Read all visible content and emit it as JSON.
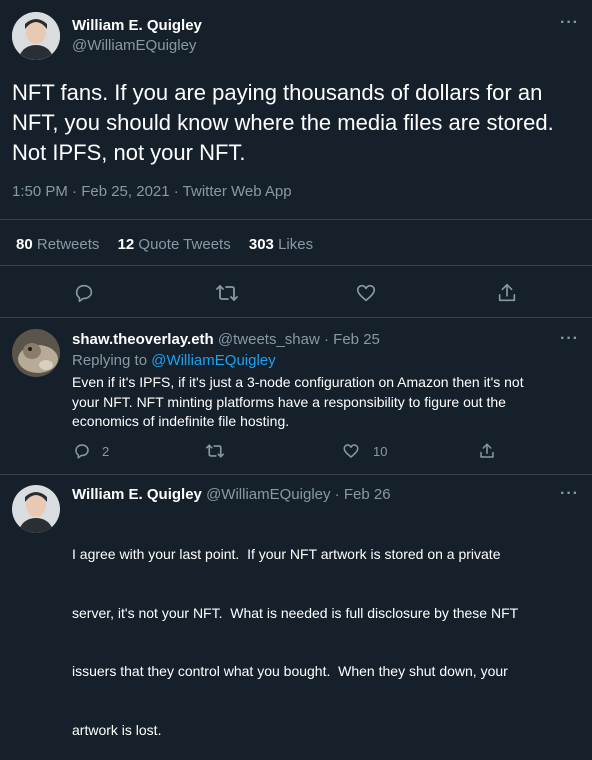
{
  "tweet": {
    "author_name": "William E. Quigley",
    "author_handle": "@WilliamEQuigley",
    "text_lines": [
      "NFT fans. If you are paying thousands of dollars for an",
      "NFT, you should know where the media files are stored.",
      "Not IPFS, not your NFT."
    ],
    "meta": "1:50 PM · Feb 25, 2021 · Twitter Web App",
    "stats": {
      "retweets_count": "80",
      "retweets_label": "Retweets",
      "quotes_count": "12",
      "quotes_label": "Quote Tweets",
      "likes_count": "303",
      "likes_label": "Likes"
    },
    "more_label": "···"
  },
  "replies": [
    {
      "author_name": "shaw.theoverlay.eth",
      "author_handle": "@tweets_shaw",
      "date": "· Feb 25",
      "replying_to_prefix": "Replying to",
      "replying_to_handle": "@WilliamEQuigley",
      "text_lines": [
        "Even if it's IPFS, if it's just a 3-node configuration on Amazon then it's not",
        "your NFT. NFT minting platforms have a responsibility to figure out the",
        "economics of indefinite file hosting."
      ],
      "reply_count": "2",
      "like_count": "10",
      "more_label": "···"
    },
    {
      "author_name": "William E. Quigley",
      "author_handle": "@WilliamEQuigley",
      "date": "· Feb 26",
      "text_lines": [
        "I agree with your last point.  If your NFT artwork is stored on a private",
        "server, it's not your NFT.  What is needed is full disclosure by these NFT",
        "issuers that they control what you bought.  When they shut down, your",
        "artwork is lost."
      ],
      "more_label": "···"
    }
  ],
  "icons": {
    "reply": "reply-icon",
    "retweet": "retweet-icon",
    "like": "heart-icon",
    "share": "share-icon"
  },
  "colors": {
    "background": "#15202b",
    "divider": "#38444d",
    "muted": "#8899a6",
    "accent": "#1da1f2"
  }
}
